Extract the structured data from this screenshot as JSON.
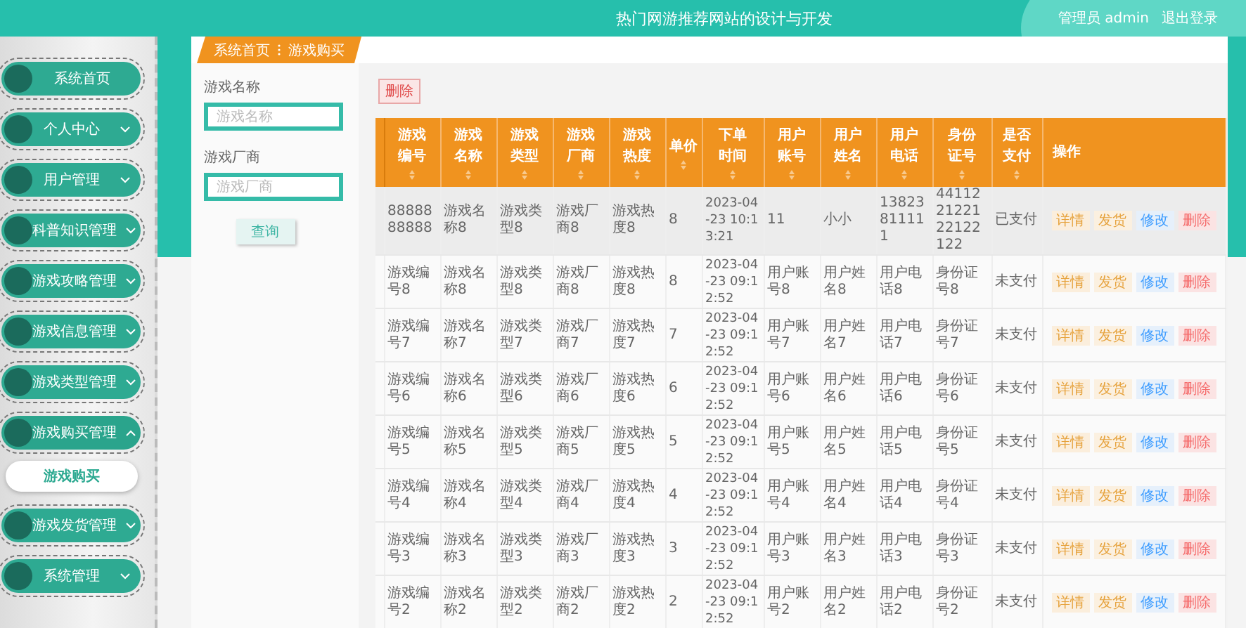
{
  "header": {
    "title": "热门网游推荐网站的设计与开发",
    "user": "管理员 admin",
    "logout": "退出登录"
  },
  "sidebar": {
    "items": [
      {
        "label": "系统首页"
      },
      {
        "label": "个人中心",
        "expanded": false
      },
      {
        "label": "用户管理",
        "expanded": false
      },
      {
        "label": "科普知识管理",
        "expanded": false
      },
      {
        "label": "游戏攻略管理",
        "expanded": false
      },
      {
        "label": "游戏信息管理",
        "expanded": false
      },
      {
        "label": "游戏类型管理",
        "expanded": false
      },
      {
        "label": "游戏购买管理",
        "expanded": true,
        "children": [
          {
            "label": "游戏购买",
            "selected": true
          }
        ]
      },
      {
        "label": "游戏发货管理",
        "expanded": false
      },
      {
        "label": "系统管理",
        "expanded": false
      }
    ]
  },
  "breadcrumb": [
    "系统首页",
    "游戏购买"
  ],
  "search": {
    "fields": [
      {
        "label": "游戏名称",
        "placeholder": "游戏名称"
      },
      {
        "label": "游戏厂商",
        "placeholder": "游戏厂商"
      }
    ],
    "button": "查询"
  },
  "toolbar": {
    "delete_button": "删除"
  },
  "table": {
    "columns": [
      {
        "label": "游戏编号",
        "sortable": true
      },
      {
        "label": "游戏名称",
        "sortable": true
      },
      {
        "label": "游戏类型",
        "sortable": true
      },
      {
        "label": "游戏厂商",
        "sortable": true
      },
      {
        "label": "游戏热度",
        "sortable": true
      },
      {
        "label": "单价",
        "sortable": true
      },
      {
        "label": "下单时间",
        "sortable": true
      },
      {
        "label": "用户账号",
        "sortable": true
      },
      {
        "label": "用户姓名",
        "sortable": true
      },
      {
        "label": "用户电话",
        "sortable": true
      },
      {
        "label": "身份证号",
        "sortable": true
      },
      {
        "label": "是否支付",
        "sortable": true
      },
      {
        "label": "操作",
        "sortable": false
      }
    ],
    "rows": [
      {
        "highlighted": true,
        "cells": [
          "8888888888",
          "游戏名称8",
          "游戏类型8",
          "游戏厂商8",
          "游戏热度8",
          "8",
          "2023-04-23 10:13:21",
          "11",
          "小小",
          "13823811111",
          "441122122122122122",
          "已支付"
        ],
        "actions": [
          {
            "kind": "detail",
            "label": "详情"
          },
          {
            "kind": "ship",
            "label": "发货"
          },
          {
            "kind": "edit",
            "label": "修改"
          },
          {
            "kind": "delete",
            "label": "删除"
          }
        ]
      },
      {
        "highlighted": false,
        "cells": [
          "游戏编号8",
          "游戏名称8",
          "游戏类型8",
          "游戏厂商8",
          "游戏热度8",
          "8",
          "2023-04-23 09:12:52",
          "用户账号8",
          "用户姓名8",
          "用户电话8",
          "身份证号8",
          "未支付"
        ],
        "actions": [
          {
            "kind": "detail",
            "label": "详情"
          },
          {
            "kind": "ship",
            "label": "发货"
          },
          {
            "kind": "edit",
            "label": "修改"
          },
          {
            "kind": "delete",
            "label": "删除"
          }
        ]
      },
      {
        "highlighted": false,
        "cells": [
          "游戏编号7",
          "游戏名称7",
          "游戏类型7",
          "游戏厂商7",
          "游戏热度7",
          "7",
          "2023-04-23 09:12:52",
          "用户账号7",
          "用户姓名7",
          "用户电话7",
          "身份证号7",
          "未支付"
        ],
        "actions": [
          {
            "kind": "detail",
            "label": "详情"
          },
          {
            "kind": "ship",
            "label": "发货"
          },
          {
            "kind": "edit",
            "label": "修改"
          },
          {
            "kind": "delete",
            "label": "删除"
          }
        ]
      },
      {
        "highlighted": false,
        "cells": [
          "游戏编号6",
          "游戏名称6",
          "游戏类型6",
          "游戏厂商6",
          "游戏热度6",
          "6",
          "2023-04-23 09:12:52",
          "用户账号6",
          "用户姓名6",
          "用户电话6",
          "身份证号6",
          "未支付"
        ],
        "actions": [
          {
            "kind": "detail",
            "label": "详情"
          },
          {
            "kind": "ship",
            "label": "发货"
          },
          {
            "kind": "edit",
            "label": "修改"
          },
          {
            "kind": "delete",
            "label": "删除"
          }
        ]
      },
      {
        "highlighted": false,
        "cells": [
          "游戏编号5",
          "游戏名称5",
          "游戏类型5",
          "游戏厂商5",
          "游戏热度5",
          "5",
          "2023-04-23 09:12:52",
          "用户账号5",
          "用户姓名5",
          "用户电话5",
          "身份证号5",
          "未支付"
        ],
        "actions": [
          {
            "kind": "detail",
            "label": "详情"
          },
          {
            "kind": "ship",
            "label": "发货"
          },
          {
            "kind": "edit",
            "label": "修改"
          },
          {
            "kind": "delete",
            "label": "删除"
          }
        ]
      },
      {
        "highlighted": false,
        "cells": [
          "游戏编号4",
          "游戏名称4",
          "游戏类型4",
          "游戏厂商4",
          "游戏热度4",
          "4",
          "2023-04-23 09:12:52",
          "用户账号4",
          "用户姓名4",
          "用户电话4",
          "身份证号4",
          "未支付"
        ],
        "actions": [
          {
            "kind": "detail",
            "label": "详情"
          },
          {
            "kind": "ship",
            "label": "发货"
          },
          {
            "kind": "edit",
            "label": "修改"
          },
          {
            "kind": "delete",
            "label": "删除"
          }
        ]
      },
      {
        "highlighted": false,
        "cells": [
          "游戏编号3",
          "游戏名称3",
          "游戏类型3",
          "游戏厂商3",
          "游戏热度3",
          "3",
          "2023-04-23 09:12:52",
          "用户账号3",
          "用户姓名3",
          "用户电话3",
          "身份证号3",
          "未支付"
        ],
        "actions": [
          {
            "kind": "detail",
            "label": "详情"
          },
          {
            "kind": "ship",
            "label": "发货"
          },
          {
            "kind": "edit",
            "label": "修改"
          },
          {
            "kind": "delete",
            "label": "删除"
          }
        ]
      },
      {
        "highlighted": false,
        "cells": [
          "游戏编号2",
          "游戏名称2",
          "游戏类型2",
          "游戏厂商2",
          "游戏热度2",
          "2",
          "2023-04-23 09:12:52",
          "用户账号2",
          "用户姓名2",
          "用户电话2",
          "身份证号2",
          "未支付"
        ],
        "actions": [
          {
            "kind": "detail",
            "label": "详情"
          },
          {
            "kind": "ship",
            "label": "发货"
          },
          {
            "kind": "edit",
            "label": "修改"
          },
          {
            "kind": "delete",
            "label": "删除"
          }
        ]
      }
    ]
  }
}
